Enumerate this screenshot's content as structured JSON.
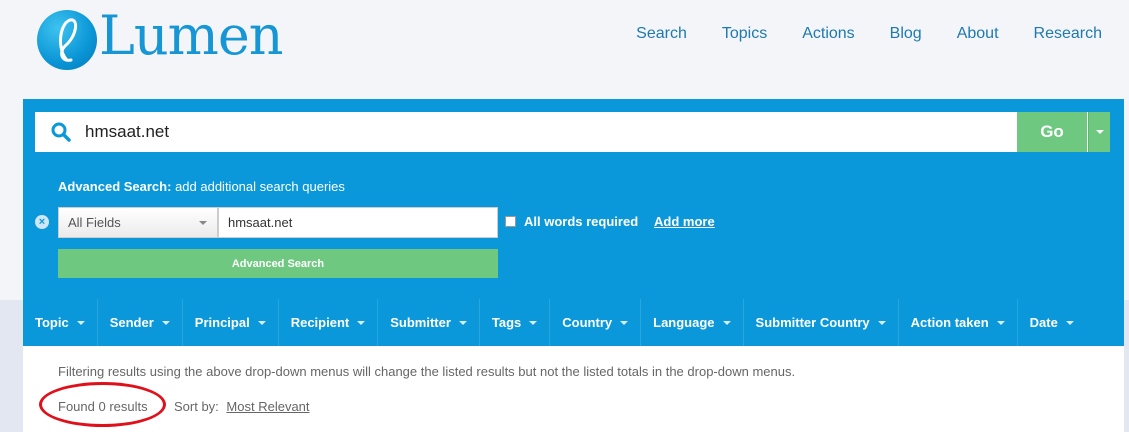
{
  "brand": {
    "name": "Lumen"
  },
  "nav": [
    {
      "label": "Search"
    },
    {
      "label": "Topics"
    },
    {
      "label": "Actions"
    },
    {
      "label": "Blog"
    },
    {
      "label": "About"
    },
    {
      "label": "Research"
    }
  ],
  "search": {
    "query": "hmsaat.net",
    "go_label": "Go"
  },
  "advanced": {
    "title": "Advanced Search:",
    "subtitle": "add additional search queries",
    "field_selected": "All Fields",
    "field_value": "hmsaat.net",
    "all_words_label": "All words required",
    "add_more_label": "Add more",
    "button_label": "Advanced Search"
  },
  "filters": [
    {
      "label": "Topic"
    },
    {
      "label": "Sender"
    },
    {
      "label": "Principal"
    },
    {
      "label": "Recipient"
    },
    {
      "label": "Submitter"
    },
    {
      "label": "Tags"
    },
    {
      "label": "Country"
    },
    {
      "label": "Language"
    },
    {
      "label": "Submitter Country"
    },
    {
      "label": "Action taken"
    },
    {
      "label": "Date"
    }
  ],
  "results": {
    "note": "Filtering results using the above drop-down menus will change the listed results but not the listed totals in the drop-down menus.",
    "found": "Found 0 results",
    "sort_label": "Sort by:",
    "sort_value": "Most Relevant"
  },
  "colors": {
    "panel": "#0b98da",
    "go": "#6fc880",
    "annotation": "#e0101a"
  },
  "icons": [
    "search-icon",
    "remove-icon",
    "chevron-down-icon"
  ]
}
